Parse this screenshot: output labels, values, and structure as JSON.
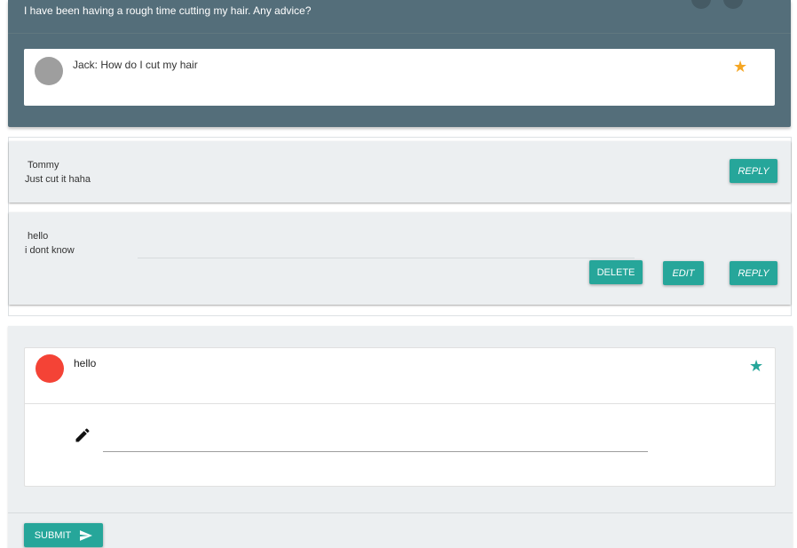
{
  "post": {
    "title_text": "I have been having a rough time cutting my hair. Any advice?",
    "question": "Jack: How do I cut my hair",
    "star_icon": "star-icon",
    "star_color": "#f5a623"
  },
  "replies": [
    {
      "author": "Tommy",
      "text": "Just cut it haha",
      "reply_label": "REPLY"
    },
    {
      "author": "hello",
      "text": "i dont know",
      "delete_label": "DELETE",
      "edit_label": "EDIT",
      "reply_label": "REPLY"
    }
  ],
  "compose": {
    "user_label": "hello",
    "star_icon": "star-icon",
    "star_color": "#26a69a",
    "pencil_icon": "pencil-icon",
    "input_value": "",
    "submit_label": "SUBMIT",
    "submit_icon": "send-icon"
  },
  "colors": {
    "header_bg": "#546e7a",
    "accent": "#26a69a",
    "avatar_grey": "#9e9e9e",
    "avatar_red": "#f44336",
    "section_bg": "#eceff1"
  }
}
